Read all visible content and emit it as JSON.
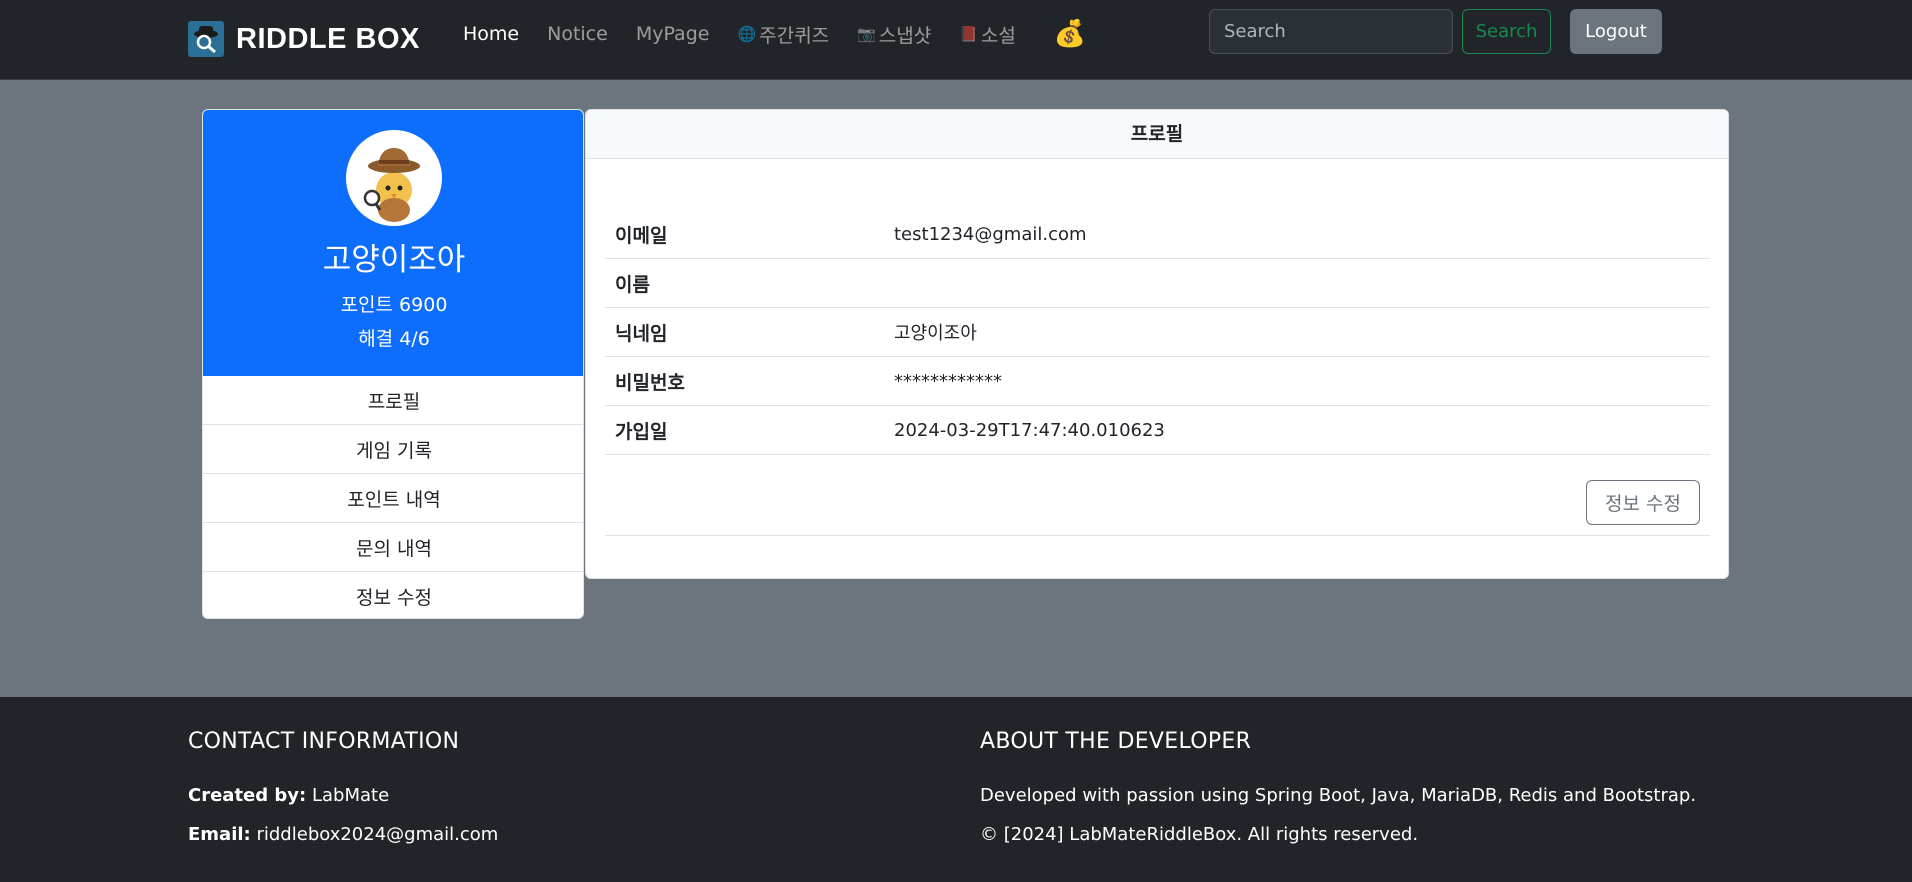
{
  "navbar": {
    "brand": "RIDDLE BOX",
    "links": [
      {
        "label": "Home",
        "active": true
      },
      {
        "label": "Notice",
        "active": false
      },
      {
        "label": "MyPage",
        "active": false
      },
      {
        "label": "주간퀴즈",
        "icon": "globe-icon"
      },
      {
        "label": "스냅샷",
        "icon": "camera-icon"
      },
      {
        "label": "소설",
        "icon": "book-icon"
      }
    ],
    "money_icon": "money-bag-icon",
    "search_placeholder": "Search",
    "search_button": "Search",
    "logout_button": "Logout"
  },
  "sidebar": {
    "name": "고양이조아",
    "points": "포인트 6900",
    "solved": "해결 4/6",
    "menu": [
      "프로필",
      "게임 기록",
      "포인트 내역",
      "문의 내역",
      "정보 수정"
    ]
  },
  "profile": {
    "title": "프로필",
    "rows": [
      {
        "label": "이메일",
        "value": "test1234@gmail.com"
      },
      {
        "label": "이름",
        "value": ""
      },
      {
        "label": "닉네임",
        "value": "고양이조아"
      },
      {
        "label": "비밀번호",
        "value": "************"
      },
      {
        "label": "가입일",
        "value": "2024-03-29T17:47:40.010623"
      }
    ],
    "edit_button": "정보 수정"
  },
  "footer": {
    "contact_title": "CONTACT INFORMATION",
    "created_by_label": "Created by:",
    "created_by_value": "LabMate",
    "email_label": "Email:",
    "email_value": "riddlebox2024@gmail.com",
    "about_title": "ABOUT THE DEVELOPER",
    "about_text": "Developed with passion using Spring Boot, Java, MariaDB, Redis and Bootstrap.",
    "copyright": "© [2024] LabMateRiddleBox. All rights reserved."
  },
  "colors": {
    "navbar_bg": "#212529",
    "page_bg": "#6c757d",
    "profile_header": "#0d6efd",
    "search_green": "#198754"
  }
}
